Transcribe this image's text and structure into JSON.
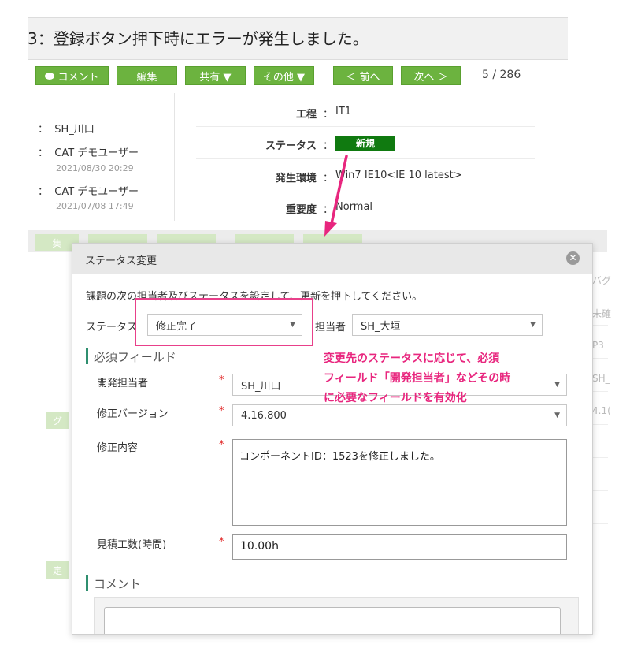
{
  "issue": {
    "title": "3：登録ボタン押下時にエラーが発生しました。",
    "toolbar": {
      "comment": "コメント",
      "edit": "編集",
      "share": "共有 ▼",
      "other": "その他 ▼",
      "prev": "＜ 前へ",
      "next": "次へ ＞",
      "counter": "5 / 286"
    },
    "people": [
      {
        "name": "SH_川口",
        "date": ""
      },
      {
        "name": "CAT デモユーザー",
        "date": "2021/08/30 20:29"
      },
      {
        "name": "CAT デモユーザー",
        "date": "2021/07/08 17:49"
      }
    ],
    "fields": {
      "process_label": "工程",
      "process_value": "IT1",
      "status_label": "ステータス",
      "status_value": "新規",
      "env_label": "発生環境",
      "env_value": "Win7 IE10<IE 10 latest>",
      "severity_label": "重要度",
      "severity_value": "Normal"
    },
    "faded_left": {
      "item1": "集",
      "item2": "グ",
      "item3": "定"
    },
    "faded_right": {
      "r1": "バグ",
      "r2": "未確",
      "r3": "P3",
      "r4": "SH_",
      "r5": "4.1("
    }
  },
  "modal": {
    "title": "ステータス変更",
    "instruction": "課題の次の担当者及びステータスを設定して、更新を押下してください。",
    "status_label": "ステータス",
    "status_value": "修正完了",
    "assignee_label": "担当者",
    "assignee_value": "SH_大垣",
    "required_section": "必須フィールド",
    "dev_assignee_label": "開発担当者",
    "dev_assignee_value": "SH_川口",
    "fix_version_label": "修正バージョン",
    "fix_version_value": "4.16.800",
    "fix_content_label": "修正内容",
    "fix_content_value": "コンポーネントID：1523を修正しました。",
    "estimate_label": "見積工数(時間)",
    "estimate_value": "10.00h",
    "required_mark": "*",
    "comment_section": "コメント"
  },
  "annotation": {
    "line1": "変更先のステータスに応じて、必須",
    "line2": "フィールド「開発担当者」などその時",
    "line3": "に必要なフィールドを有効化",
    "color": "#e8267e"
  }
}
